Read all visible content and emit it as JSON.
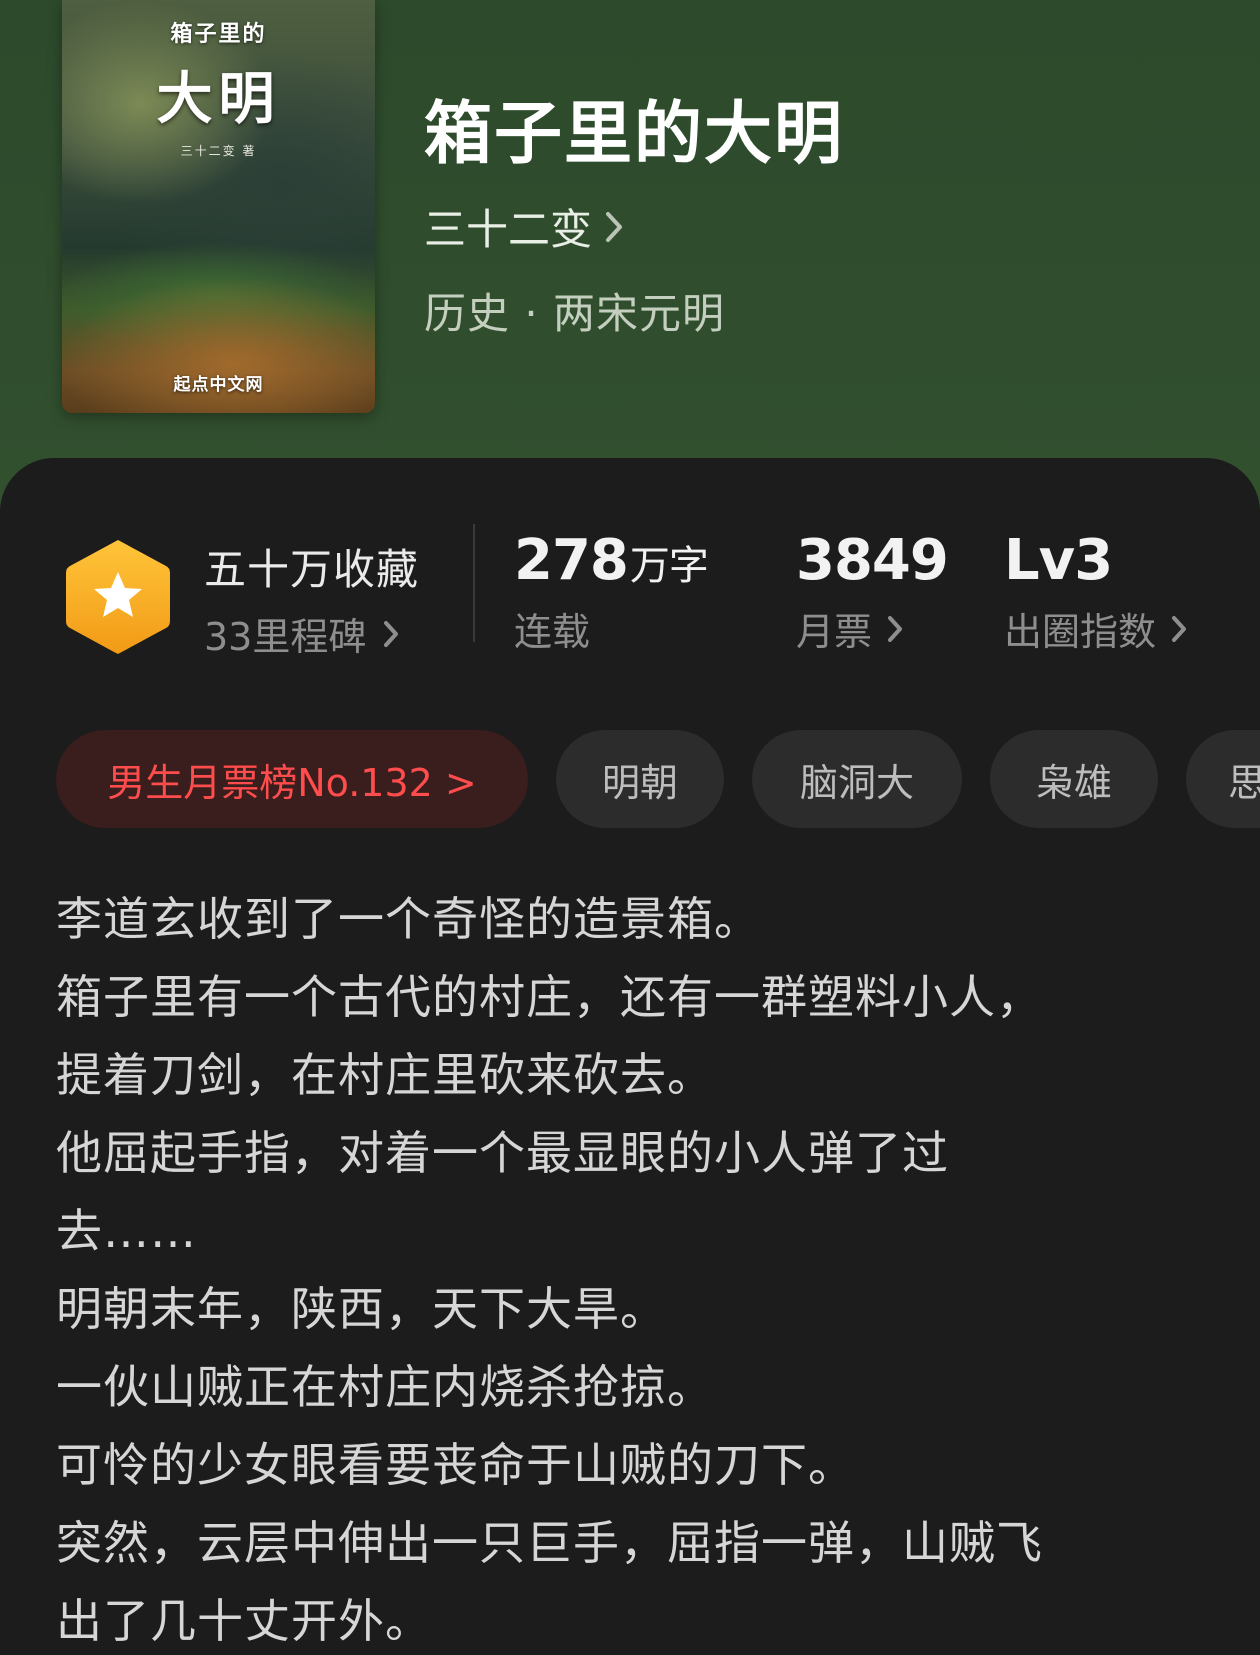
{
  "cover": {
    "top_text": "箱子里的",
    "big_text": "大明",
    "author_text": "三十二变 著",
    "publisher": "起点中文网"
  },
  "book": {
    "title": "箱子里的大明",
    "author": "三十二变",
    "category": "历史 · 两宋元明"
  },
  "stats": {
    "collect_title": "五十万收藏",
    "collect_sub": "33里程碑",
    "words_value": "278",
    "words_unit": "万字",
    "words_label": "连载",
    "tickets_value": "3849",
    "tickets_label": "月票",
    "level_value": "Lv3",
    "level_label": "出圈指数"
  },
  "tags": {
    "rank": "男生月票榜No.132 >",
    "items": [
      "明朝",
      "脑洞大",
      "枭雄",
      "思"
    ]
  },
  "synopsis": [
    "李道玄收到了一个奇怪的造景箱。",
    "箱子里有一个古代的村庄，还有一群塑料小人，",
    "提着刀剑，在村庄里砍来砍去。",
    "他屈起手指，对着一个最显眼的小人弹了过",
    "去……",
    "明朝末年，陕西，天下大旱。",
    "一伙山贼正在村庄内烧杀抢掠。",
    "可怜的少女眼看要丧命于山贼的刀下。",
    "突然，云层中伸出一只巨手，屈指一弹，山贼飞",
    "出了几十丈开外。"
  ],
  "colors": {
    "rank_text": "#ff4c4c",
    "badge": "#f5a623",
    "sheet_bg": "#1c1c1c"
  }
}
